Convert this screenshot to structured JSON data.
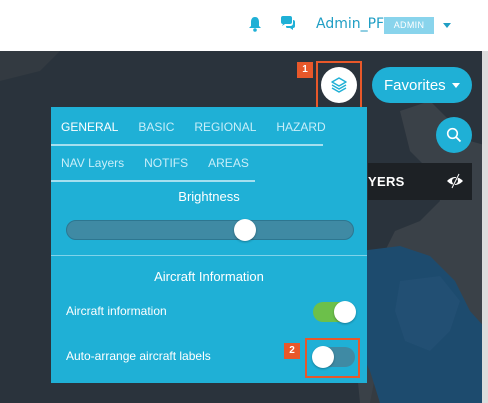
{
  "topbar": {
    "username": "Admin_PF",
    "role_badge": "ADMIN",
    "icons": [
      "bell-icon",
      "chat-icon",
      "caret-down-icon"
    ]
  },
  "map_controls": {
    "favorites_label": "Favorites",
    "layers_strip_label": "YERS",
    "callouts": [
      "1",
      "2"
    ]
  },
  "panel": {
    "tabs_row1": [
      "GENERAL",
      "BASIC",
      "REGIONAL",
      "HAZARD"
    ],
    "tabs_row2": [
      "NAV Layers",
      "NOTIFS",
      "AREAS"
    ],
    "active_tab": "GENERAL",
    "brightness_title": "Brightness",
    "brightness_level": 0.63,
    "aircraft_section_title": "Aircraft Information",
    "options": [
      {
        "label": "Aircraft information",
        "on": true
      },
      {
        "label": "Auto-arrange aircraft labels",
        "on": false
      }
    ]
  },
  "colors": {
    "accent": "#1fb0d6",
    "highlight": "#e8582a",
    "toggle_on": "#6cc04a"
  }
}
